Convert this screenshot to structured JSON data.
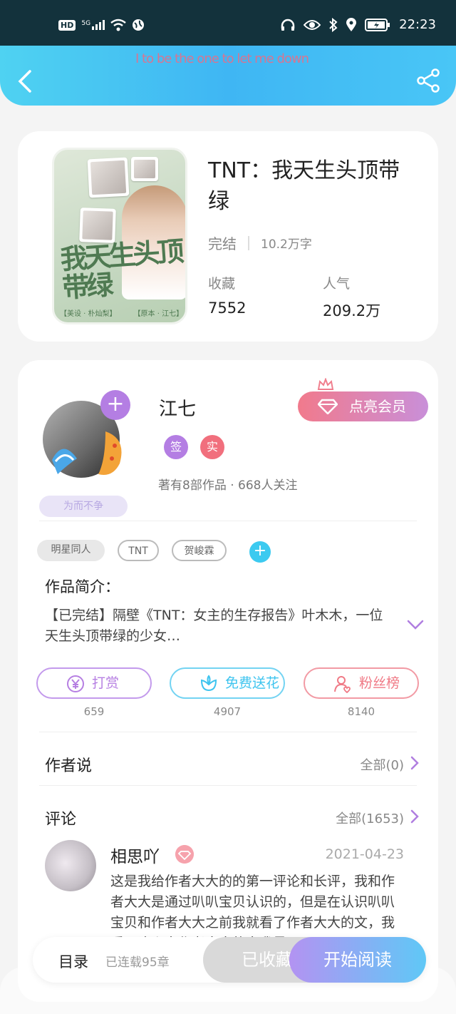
{
  "status_bar": {
    "network_badge": "HD",
    "signal_label": "5G",
    "time": "22:23",
    "icons": [
      "wifi-icon",
      "globe-icon",
      "headphones-icon",
      "eye-icon",
      "bluetooth-icon",
      "location-icon",
      "battery-icon"
    ]
  },
  "nav": {
    "lyric": "I to be the one to let me down",
    "icons": [
      "back-icon",
      "share-icon"
    ]
  },
  "book": {
    "title": "TNT：我天生头顶带绿",
    "cover_title": "我天生头顶带绿",
    "cover_tag_left": "【美设 · 朴灿梨】",
    "cover_tag_right": "【原本 · 江七】",
    "status": "完结",
    "word_count": "10.2万字",
    "favorites_label": "收藏",
    "favorites_value": "7552",
    "popularity_label": "人气",
    "popularity_value": "209.2万"
  },
  "author": {
    "name": "江七",
    "tagline": "为而不争",
    "vip_button": "点亮会员",
    "badges": [
      {
        "label": "签",
        "color": "#b47ee3"
      },
      {
        "label": "实",
        "color": "#f16f7d"
      }
    ],
    "info": "著有8部作品 · 668人关注"
  },
  "tags": [
    "明星同人",
    "TNT",
    "贺峻霖"
  ],
  "intro": {
    "heading": "作品简介：",
    "text": "【已完结】隔壁《TNT：女主的生存报告》叶木木，一位天生头顶带绿的少女…"
  },
  "actions": [
    {
      "label": "打赏",
      "count": "659",
      "color": "#b67fe2",
      "icon": "yen-icon"
    },
    {
      "label": "免费送花",
      "count": "4907",
      "color": "#3ec4ef",
      "icon": "flower-icon"
    },
    {
      "label": "粉丝榜",
      "count": "8140",
      "color": "#f07a86",
      "icon": "fan-icon"
    }
  ],
  "author_says": {
    "heading": "作者说",
    "link": "全部(0)"
  },
  "comments": {
    "heading": "评论",
    "link": "全部(1653)",
    "first": {
      "name": "相思吖",
      "date": "2021-04-23",
      "text": "这是我给作者大大的的第一评论和长评，我和作者大大是通过叭叭宝贝认识的，但是在认识叭叭宝贝和作者大大之前我就看了作者大大的文，我看了这么多作者大大的文我最"
    }
  },
  "bottom_bar": {
    "toc": "目录",
    "serial": "已连载95章",
    "collected": "已收藏",
    "read": "开始阅读"
  }
}
